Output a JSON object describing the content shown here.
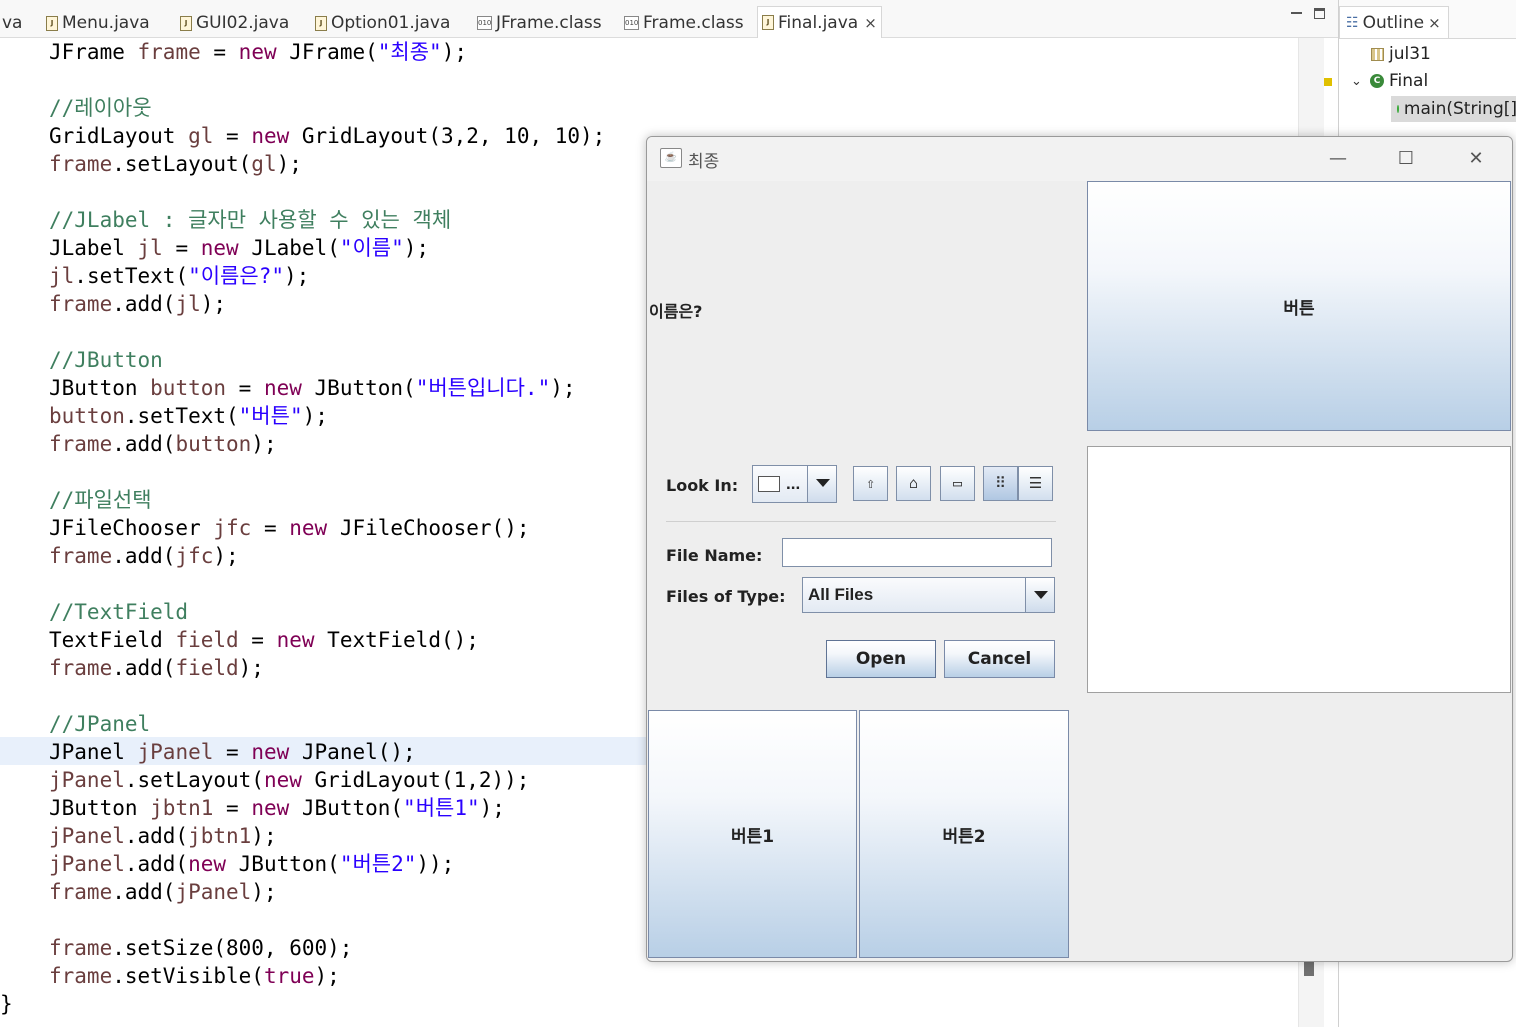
{
  "editor_tabs": [
    {
      "label": "va",
      "kind": "partial"
    },
    {
      "label": "Menu.java",
      "kind": "java"
    },
    {
      "label": "GUI02.java",
      "kind": "java"
    },
    {
      "label": "Option01.java",
      "kind": "java"
    },
    {
      "label": "JFrame.class",
      "kind": "class"
    },
    {
      "label": "Frame.class",
      "kind": "class"
    },
    {
      "label": "Final.java",
      "kind": "java",
      "active": true,
      "close": "×"
    }
  ],
  "code_lines": [
    "JFrame frame = new JFrame(\"최종\");",
    "",
    "//레이아웃",
    "GridLayout gl = new GridLayout(3,2, 10, 10);",
    "frame.setLayout(gl);",
    "",
    "//JLabel : 글자만 사용할 수 있는 객체",
    "JLabel jl = new JLabel(\"이름\");",
    "jl.setText(\"이름은?\");",
    "frame.add(jl);",
    "",
    "//JButton",
    "JButton button = new JButton(\"버튼입니다.\");",
    "button.setText(\"버튼\");",
    "frame.add(button);",
    "",
    "//파일선택",
    "JFileChooser jfc = new JFileChooser();",
    "frame.add(jfc);",
    "",
    "//TextField",
    "TextField field = new TextField();",
    "frame.add(field);",
    "",
    "//JPanel",
    "JPanel jPanel = new JPanel();",
    "jPanel.setLayout(new GridLayout(1,2));",
    "JButton jbtn1 = new JButton(\"버튼1\");",
    "jPanel.add(jbtn1);",
    "jPanel.add(new JButton(\"버튼2\"));",
    "frame.add(jPanel);",
    "",
    "frame.setSize(800, 600);",
    "frame.setVisible(true);",
    "}"
  ],
  "highlighted_line": 25,
  "outline": {
    "title": "Outline",
    "close": "×",
    "items": [
      {
        "label": "jul31",
        "icon": "package-icon"
      },
      {
        "label": "Final",
        "icon": "class-icon",
        "expanded": true
      },
      {
        "label": "main(String[]",
        "icon": "method-icon",
        "selected": true
      }
    ]
  },
  "java_window": {
    "title": "최종",
    "controls": {
      "minimize": "—",
      "maximize": "☐",
      "close": "✕"
    },
    "label": "이름은?",
    "button": "버튼",
    "file_chooser": {
      "look_in_label": "Look In:",
      "look_in_value": "...",
      "file_name_label": "File Name:",
      "file_name_value": "",
      "files_of_type_label": "Files of Type:",
      "files_of_type_value": "All Files",
      "open_button": "Open",
      "cancel_button": "Cancel",
      "toolbar": [
        "up-one-level-icon",
        "home-icon",
        "new-folder-icon",
        "list-view-icon",
        "details-view-icon"
      ]
    },
    "panel_buttons": [
      "버튼1",
      "버튼2"
    ]
  },
  "colors": {
    "keyword": "#7f0055",
    "string": "#2a00ff",
    "comment": "#3f7f5f",
    "field": "#6a3e3e",
    "button_gradient_bottom": "#b8cfe6"
  }
}
